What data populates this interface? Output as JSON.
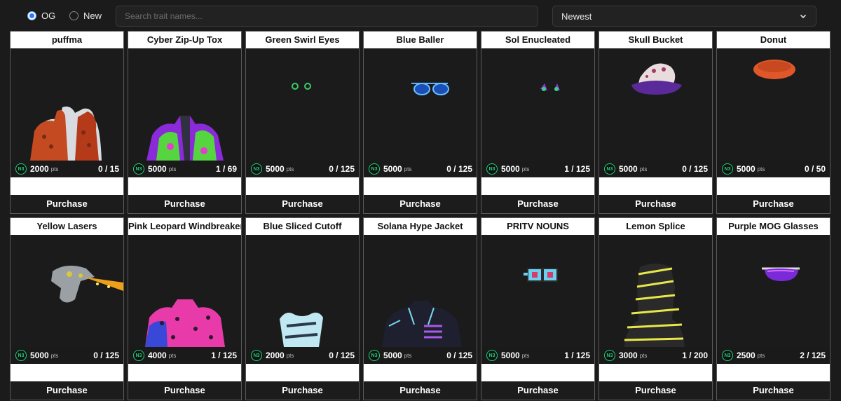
{
  "filters": {
    "radio_og": "OG",
    "radio_new": "New",
    "selected": "OG",
    "search_placeholder": "Search trait names...",
    "sort_value": "Newest"
  },
  "currency_badge": "N3",
  "pts_unit": "pts",
  "purchase_label": "Purchase",
  "items": [
    {
      "name": "puffma",
      "price": "2000",
      "supply": "0 / 15"
    },
    {
      "name": "Cyber Zip-Up Tox",
      "price": "5000",
      "supply": "1 / 69"
    },
    {
      "name": "Green Swirl Eyes",
      "price": "5000",
      "supply": "0 / 125"
    },
    {
      "name": "Blue Baller",
      "price": "5000",
      "supply": "0 / 125"
    },
    {
      "name": "Sol Enucleated",
      "price": "5000",
      "supply": "1 / 125"
    },
    {
      "name": "Skull Bucket",
      "price": "5000",
      "supply": "0 / 125"
    },
    {
      "name": "Donut",
      "price": "5000",
      "supply": "0 / 50"
    },
    {
      "name": "Yellow Lasers",
      "price": "5000",
      "supply": "0 / 125"
    },
    {
      "name": "Pink Leopard Windbreaker",
      "price": "4000",
      "supply": "1 / 125"
    },
    {
      "name": "Blue Sliced Cutoff",
      "price": "2000",
      "supply": "0 / 125"
    },
    {
      "name": "Solana Hype Jacket",
      "price": "5000",
      "supply": "0 / 125"
    },
    {
      "name": "PRITV NOUNS",
      "price": "5000",
      "supply": "1 / 125"
    },
    {
      "name": "Lemon Splice",
      "price": "3000",
      "supply": "1 / 200"
    },
    {
      "name": "Purple MOG Glasses",
      "price": "2500",
      "supply": "2 / 125"
    }
  ]
}
